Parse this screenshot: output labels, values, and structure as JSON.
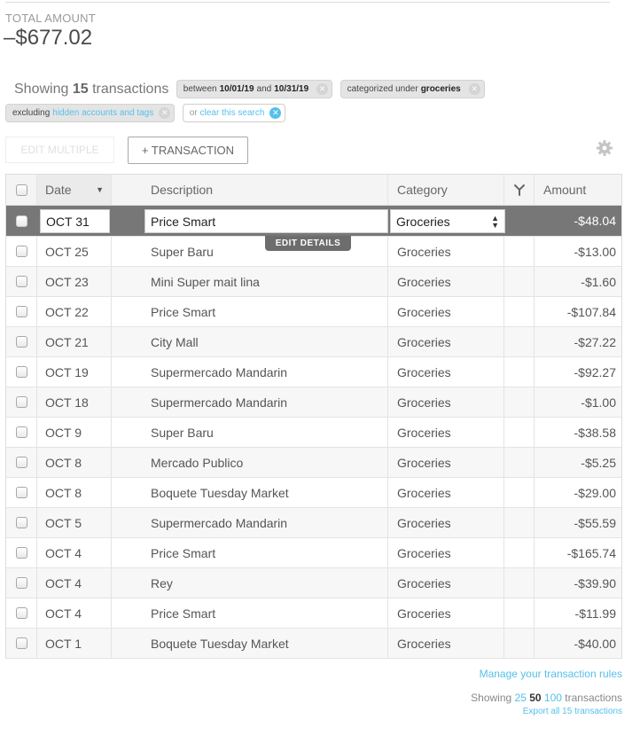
{
  "summary": {
    "total_label": "TOTAL AMOUNT",
    "total_amount": "–$677.02"
  },
  "filters": {
    "showing_prefix": "Showing",
    "showing_count": "15",
    "showing_suffix": "transactions",
    "date_chip": {
      "prefix": "between",
      "start": "10/01/19",
      "joiner": "and",
      "end": "10/31/19"
    },
    "category_chip": {
      "prefix": "categorized under",
      "value": "groceries"
    },
    "excluding_chip": {
      "prefix": "excluding",
      "link": "hidden accounts and tags"
    },
    "clear_chip": {
      "prefix": "or",
      "link": "clear this search"
    }
  },
  "toolbar": {
    "edit_multiple_label": "EDIT MULTIPLE",
    "add_transaction_label": "+ TRANSACTION"
  },
  "table": {
    "columns": {
      "date": "Date",
      "description": "Description",
      "category": "Category",
      "amount": "Amount"
    },
    "selected_row": {
      "date": "OCT 31",
      "description": "Price Smart",
      "category": "Groceries",
      "amount": "-$48.04"
    },
    "edit_details_label": "EDIT DETAILS",
    "rows": [
      {
        "date": "OCT 25",
        "description": "Super Baru",
        "category": "Groceries",
        "amount": "-$13.00"
      },
      {
        "date": "OCT 23",
        "description": "Mini Super mait lina",
        "category": "Groceries",
        "amount": "-$1.60"
      },
      {
        "date": "OCT 22",
        "description": "Price Smart",
        "category": "Groceries",
        "amount": "-$107.84"
      },
      {
        "date": "OCT 21",
        "description": "City Mall",
        "category": "Groceries",
        "amount": "-$27.22"
      },
      {
        "date": "OCT 19",
        "description": "Supermercado Mandarin",
        "category": "Groceries",
        "amount": "-$92.27"
      },
      {
        "date": "OCT 18",
        "description": "Supermercado Mandarin",
        "category": "Groceries",
        "amount": "-$1.00"
      },
      {
        "date": "OCT 9",
        "description": "Super Baru",
        "category": "Groceries",
        "amount": "-$38.58"
      },
      {
        "date": "OCT 8",
        "description": "Mercado Publico",
        "category": "Groceries",
        "amount": "-$5.25"
      },
      {
        "date": "OCT 8",
        "description": "Boquete Tuesday Market",
        "category": "Groceries",
        "amount": "-$29.00"
      },
      {
        "date": "OCT 5",
        "description": "Supermercado Mandarin",
        "category": "Groceries",
        "amount": "-$55.59"
      },
      {
        "date": "OCT 4",
        "description": "Price Smart",
        "category": "Groceries",
        "amount": "-$165.74"
      },
      {
        "date": "OCT 4",
        "description": "Rey",
        "category": "Groceries",
        "amount": "-$39.90"
      },
      {
        "date": "OCT 4",
        "description": "Price Smart",
        "category": "Groceries",
        "amount": "-$11.99"
      },
      {
        "date": "OCT 1",
        "description": "Boquete Tuesday Market",
        "category": "Groceries",
        "amount": "-$40.00"
      }
    ]
  },
  "footer": {
    "manage_rules_label": "Manage your transaction rules",
    "pager_prefix": "Showing",
    "page_sizes": [
      "25",
      "50",
      "100"
    ],
    "current_page_size": "50",
    "pager_suffix": "transactions",
    "export_label": "Export all 15 transactions"
  },
  "colors": {
    "accent": "#56c0ea",
    "selected_row": "#777777"
  },
  "icons": {
    "settings": "gear-icon",
    "split": "split-icon",
    "sort": "sort-down-icon",
    "clear": "clear-circle-icon"
  }
}
